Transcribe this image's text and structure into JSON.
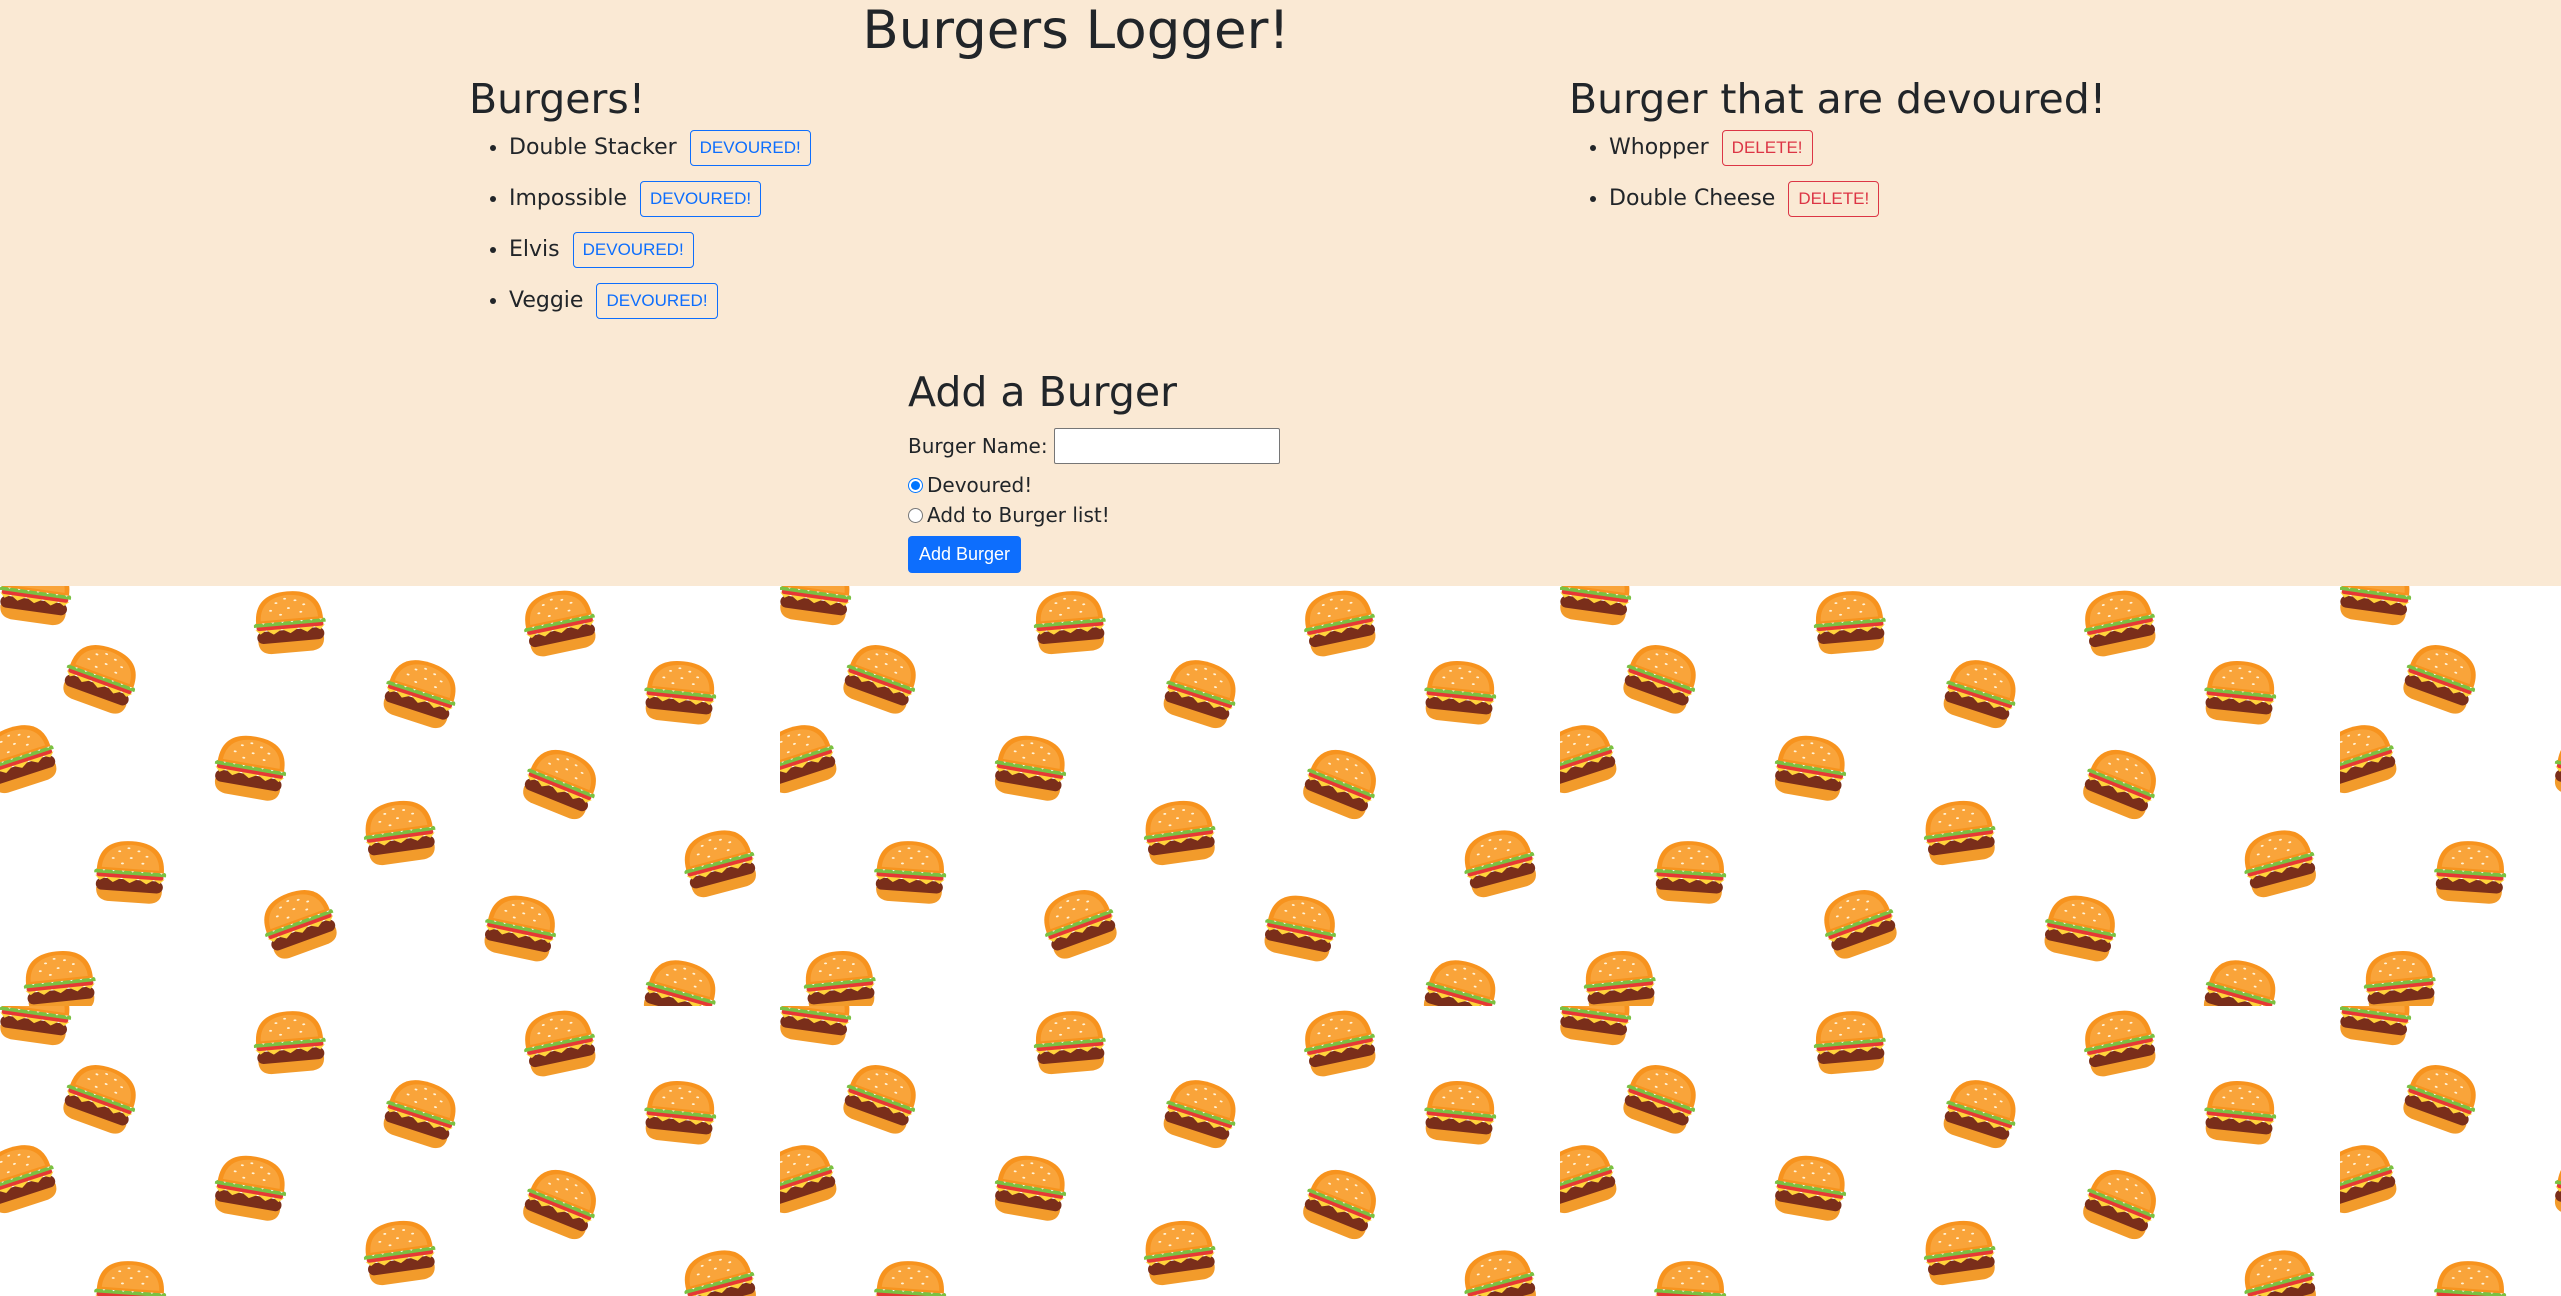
{
  "header": {
    "title": "Burgers Logger!"
  },
  "left_column": {
    "heading": "Burgers!",
    "items": [
      {
        "name": "Double Stacker",
        "button": "DEVOURED!"
      },
      {
        "name": "Impossible",
        "button": "DEVOURED!"
      },
      {
        "name": "Elvis",
        "button": "DEVOURED!"
      },
      {
        "name": "Veggie",
        "button": "DEVOURED!"
      }
    ]
  },
  "right_column": {
    "heading": "Burger that are devoured!",
    "items": [
      {
        "name": "Whopper",
        "button": "DELETE!"
      },
      {
        "name": "Double Cheese",
        "button": "DELETE!"
      }
    ]
  },
  "form": {
    "heading": "Add a Burger",
    "name_label": "Burger Name:",
    "name_value": "",
    "radio_devoured": "Devoured!",
    "radio_add": "Add to Burger list!",
    "selected": "Devoured!",
    "submit": "Add Burger"
  },
  "colors": {
    "top_background": "#fae9d4",
    "primary": "#0d6efd",
    "danger": "#dc3545",
    "bun": "#f7931e",
    "patty": "#7a2e1a",
    "cheese": "#ffd43b",
    "lettuce": "#7ac142",
    "tomato": "#e53935"
  },
  "background_icon": "burger-icon"
}
